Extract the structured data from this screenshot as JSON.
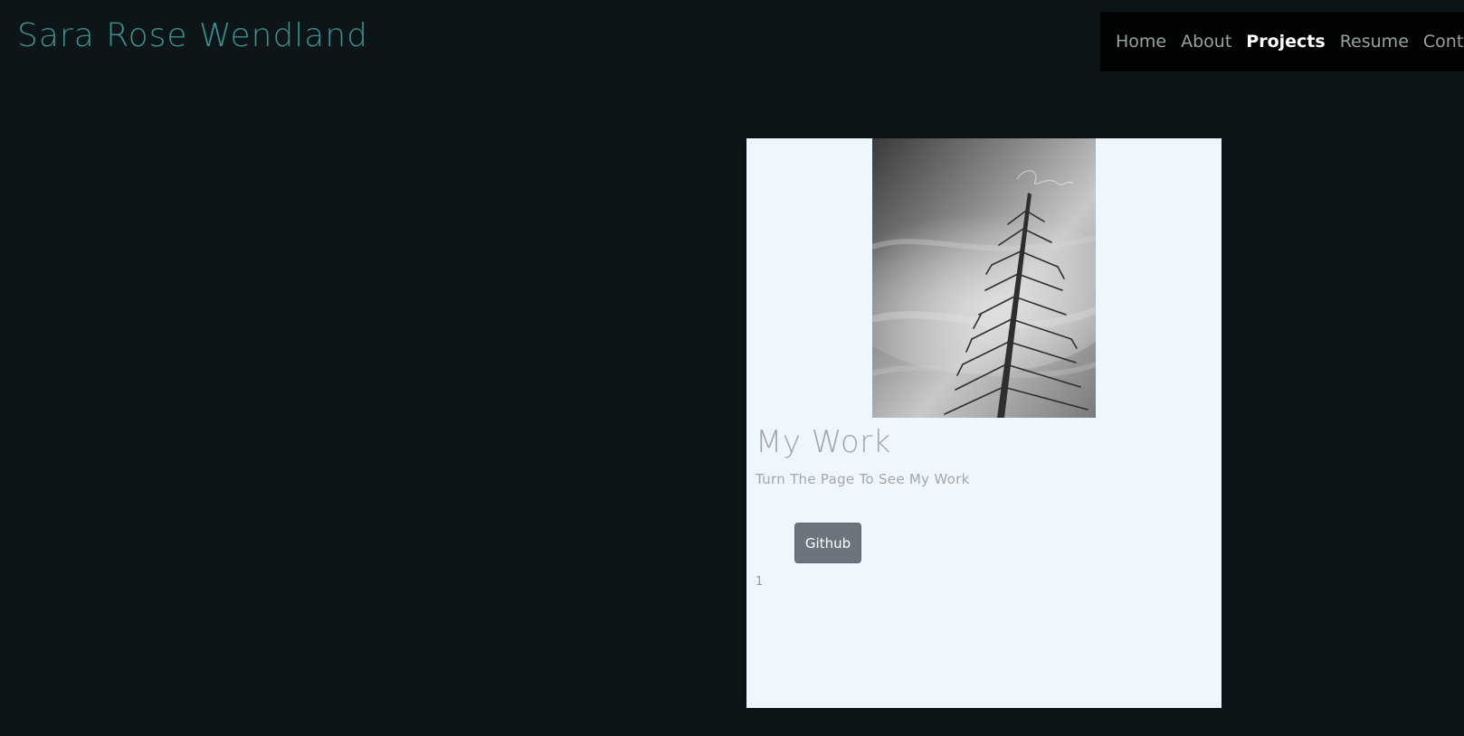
{
  "header": {
    "brand": "Sara Rose Wendland"
  },
  "nav": {
    "items": [
      {
        "label": "Home"
      },
      {
        "label": "About"
      },
      {
        "label": "Projects"
      },
      {
        "label": "Resume"
      },
      {
        "label": "Contact"
      }
    ],
    "active": "Projects"
  },
  "card": {
    "image_icon": "tree-photo",
    "title": "My Work",
    "subtitle": "Turn The Page To See My Work",
    "button_label": "Github",
    "page_number": "1"
  },
  "colors": {
    "background": "#0e1518",
    "brand": "#3f8f8f",
    "nav_background": "#020404",
    "card_background": "#eef6fe",
    "button": "#6c757d"
  }
}
